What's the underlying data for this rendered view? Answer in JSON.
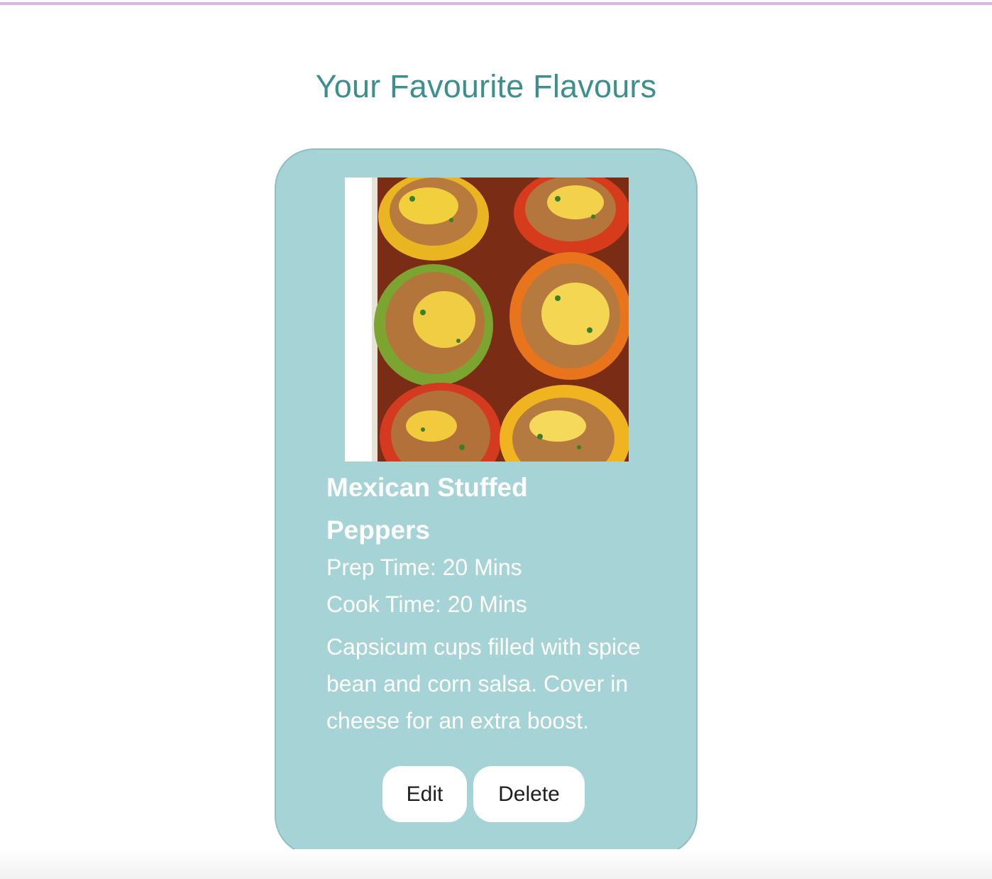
{
  "page": {
    "title": "Your Favourite Flavours"
  },
  "recipe": {
    "name": "Mexican Stuffed Peppers",
    "prep_time": "Prep Time: 20 Mins",
    "cook_time": "Cook Time: 20 Mins",
    "description": "Capsicum cups filled with spice bean and corn salsa. Cover in cheese for an extra boost.",
    "image_subject": "stuffed-peppers-photo"
  },
  "actions": {
    "edit_label": "Edit",
    "delete_label": "Delete"
  },
  "colors": {
    "title": "#3d8f8f",
    "card_background": "#a6d3d5",
    "card_border": "#8fbfc1",
    "accent_border": "#d9b3ee",
    "button_background": "#ffffff",
    "card_text": "#ffffff"
  }
}
